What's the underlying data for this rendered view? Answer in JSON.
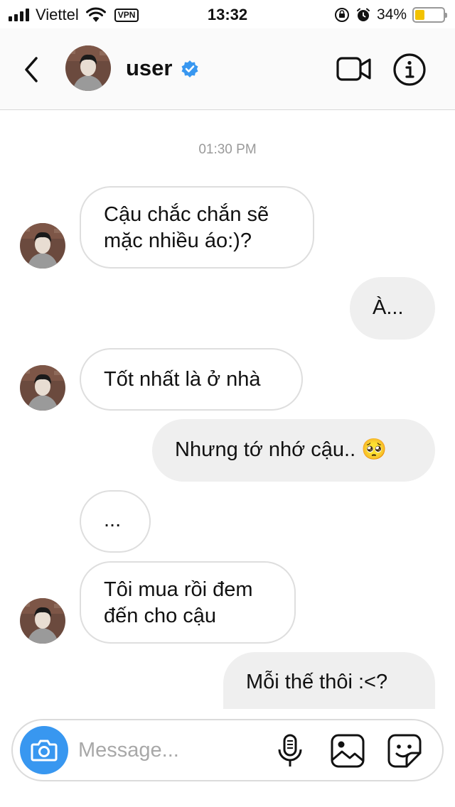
{
  "status_bar": {
    "carrier": "Viettel",
    "vpn": "VPN",
    "time": "13:32",
    "battery_percent": "34%",
    "battery_level": 0.34,
    "battery_color": "#f2c200"
  },
  "header": {
    "username": "user",
    "verified": true,
    "icons": [
      "back-chevron-icon",
      "verified-badge-icon",
      "video-call-icon",
      "info-icon"
    ]
  },
  "conversation": {
    "timestamp": "01:30 PM",
    "messages": [
      {
        "direction": "incoming",
        "lines": [
          "Cậu chắc chắn sẽ",
          "mặc nhiều áo:)?"
        ],
        "show_avatar": true
      },
      {
        "direction": "outgoing",
        "lines": [
          "À..."
        ]
      },
      {
        "direction": "incoming",
        "lines": [
          "Tốt nhất là ở nhà"
        ],
        "show_avatar": true
      },
      {
        "direction": "outgoing",
        "lines": [
          "Nhưng tớ nhớ cậu.. 🥺"
        ]
      },
      {
        "direction": "incoming",
        "lines": [
          "..."
        ],
        "show_avatar": false
      },
      {
        "direction": "incoming",
        "lines": [
          "Tôi mua rồi đem",
          "đến cho cậu"
        ],
        "show_avatar": true
      },
      {
        "direction": "outgoing",
        "lines": [
          "Mỗi thế thôi :<?"
        ]
      }
    ]
  },
  "composer": {
    "placeholder": "Message...",
    "accent_color": "#3897f0",
    "icons": [
      "camera-icon",
      "microphone-icon",
      "gallery-icon",
      "sticker-icon"
    ]
  }
}
